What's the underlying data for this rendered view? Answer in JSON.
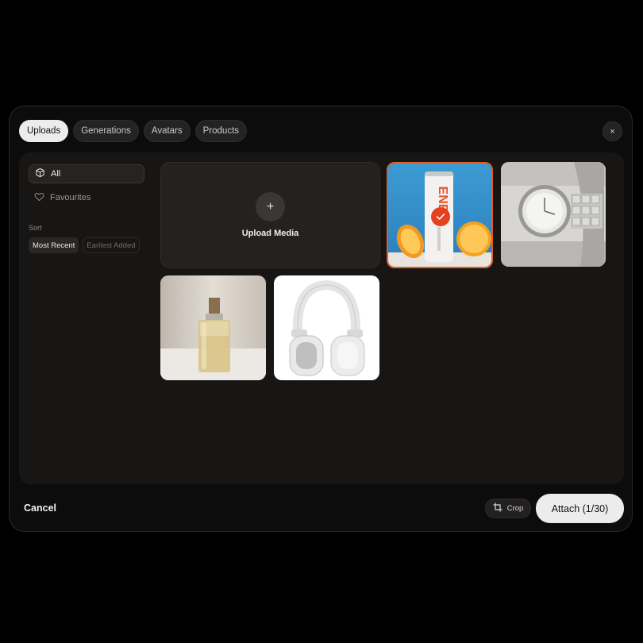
{
  "tabs": [
    {
      "label": "Uploads",
      "active": true
    },
    {
      "label": "Generations",
      "active": false
    },
    {
      "label": "Avatars",
      "active": false
    },
    {
      "label": "Products",
      "active": false
    }
  ],
  "close_icon": "×",
  "sidebar": {
    "items": [
      {
        "label": "All",
        "icon": "cube-icon",
        "active": true
      },
      {
        "label": "Favourites",
        "icon": "heart-icon",
        "active": false
      }
    ],
    "sort_label": "Sort",
    "sort_options": [
      {
        "label": "Most Recent",
        "active": true
      },
      {
        "label": "Earliest Added",
        "active": false
      }
    ]
  },
  "grid": {
    "upload_label": "Upload Media",
    "upload_icon": "+",
    "items": [
      {
        "name": "energy-drink-can",
        "selected": true
      },
      {
        "name": "silver-wristwatch",
        "selected": false
      },
      {
        "name": "perfume-bottle",
        "selected": false
      },
      {
        "name": "white-headphones",
        "selected": false
      }
    ]
  },
  "footer": {
    "cancel_label": "Cancel",
    "crop_label": "Crop",
    "attach_label": "Attach (1/30)"
  },
  "colors": {
    "selection_ring": "#e0602a",
    "check_badge": "#e5401f"
  }
}
